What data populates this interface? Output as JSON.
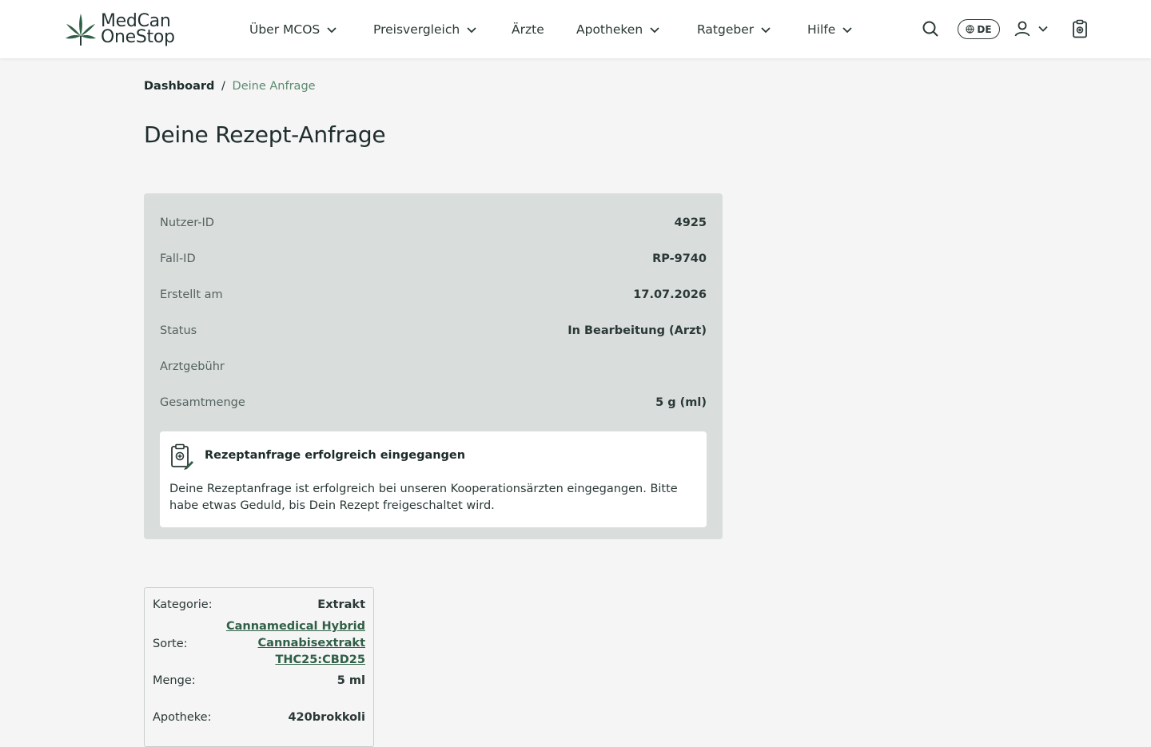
{
  "header": {
    "logo": {
      "line1": "MedCan",
      "line2": "OneStop"
    },
    "nav": [
      {
        "label": "Über MCOS",
        "dropdown": true
      },
      {
        "label": "Preisvergleich",
        "dropdown": true
      },
      {
        "label": "Ärzte",
        "dropdown": false
      },
      {
        "label": "Apotheken",
        "dropdown": true
      },
      {
        "label": "Ratgeber",
        "dropdown": true
      },
      {
        "label": "Hilfe",
        "dropdown": true
      }
    ],
    "language": "DE",
    "icons": [
      "search-icon",
      "globe-icon",
      "user-icon",
      "clipboard-icon"
    ]
  },
  "breadcrumb": {
    "parent": "Dashboard",
    "separator": "/",
    "current": "Deine Anfrage"
  },
  "page_title": "Deine Rezept-Anfrage",
  "summary": {
    "rows": [
      {
        "label": "Nutzer-ID",
        "value": "4925"
      },
      {
        "label": "Fall-ID",
        "value": "RP-9740"
      },
      {
        "label": "Erstellt am",
        "value": "17.07.2026"
      },
      {
        "label": "Status",
        "value": "In Bearbeitung (Arzt)"
      },
      {
        "label": "Arztgebühr",
        "value": ""
      },
      {
        "label": "Gesamtmenge",
        "value": "5 g (ml)"
      }
    ],
    "notice": {
      "title": "Rezeptanfrage erfolgreich eingegangen",
      "text": "Deine Rezeptanfrage ist erfolgreich bei unseren Kooperationsärzten eingegangen. Bitte habe etwas Geduld, bis Dein Rezept freigeschaltet wird."
    }
  },
  "product": {
    "rows": [
      {
        "label": "Kategorie:",
        "value": "Extrakt"
      },
      {
        "label": "Sorte:",
        "value": "Cannamedical Hybrid Cannabisextrakt THC25:CBD25"
      },
      {
        "label": "Menge:",
        "value": "5 ml"
      },
      {
        "label": "Apotheke:",
        "value": "420brokkoli"
      }
    ]
  },
  "colors": {
    "accent": "#2f5f46",
    "breadcrumb_current": "#5c8a6f",
    "card_bg": "#d9dedd",
    "page_bg": "#f5f5f5"
  }
}
